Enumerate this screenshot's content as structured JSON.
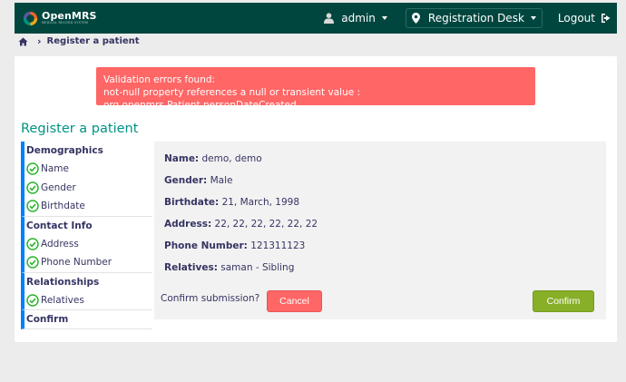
{
  "header": {
    "logo_title": "OpenMRS",
    "logo_subtitle": "MEDICAL RECORD SYSTEM",
    "user": "admin",
    "location": "Registration Desk",
    "logout": "Logout"
  },
  "breadcrumb": {
    "current": "Register a patient"
  },
  "alert": {
    "line1": "Validation errors found:",
    "line2": "not-null property references a null or transient value : org.openmrs.Patient.personDateCreated"
  },
  "page_title": "Register a patient",
  "sidebar": {
    "sections": [
      {
        "title": "Demographics",
        "items": [
          "Name",
          "Gender",
          "Birthdate"
        ]
      },
      {
        "title": "Contact Info",
        "items": [
          "Address",
          "Phone Number"
        ]
      },
      {
        "title": "Relationships",
        "items": [
          "Relatives"
        ]
      },
      {
        "title": "Confirm",
        "items": []
      }
    ]
  },
  "summary": {
    "name_label": "Name:",
    "name_value": "demo, demo",
    "gender_label": "Gender:",
    "gender_value": "Male",
    "birthdate_label": "Birthdate:",
    "birthdate_value": "21, March, 1998",
    "address_label": "Address:",
    "address_value": "22, 22, 22, 22, 22, 22",
    "phone_label": "Phone Number:",
    "phone_value": "121311123",
    "relatives_label": "Relatives:",
    "relatives_value": "saman - Sibling"
  },
  "confirm": {
    "prompt": "Confirm submission?",
    "cancel_label": "Cancel",
    "confirm_label": "Confirm"
  },
  "colors": {
    "header_bg": "#00463f",
    "title_teal": "#009384",
    "alert_red": "#ff6666",
    "confirm_green": "#88af28",
    "side_accent": "#007fff",
    "check_green": "#2bb52b"
  }
}
